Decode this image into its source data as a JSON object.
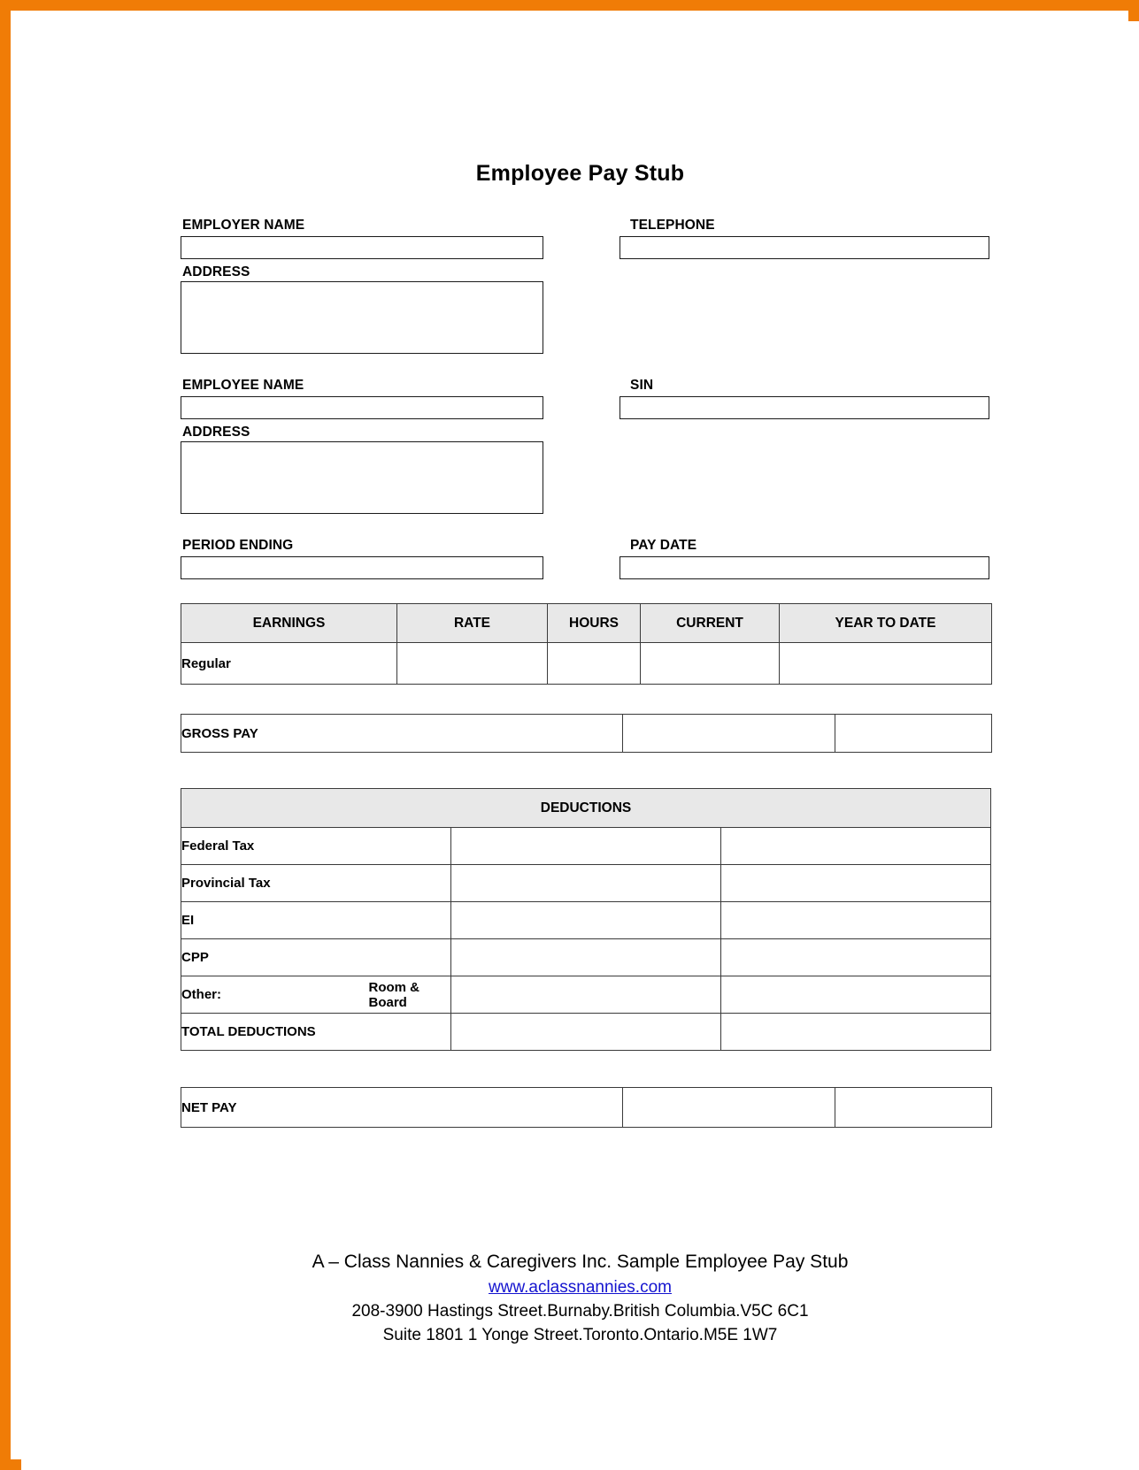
{
  "document": {
    "title": "Employee Pay Stub",
    "accent_border_color": "#f07c06",
    "header_fill_color": "#e8e8e8",
    "link_color": "#1414cf"
  },
  "employer": {
    "name_label": "EMPLOYER NAME",
    "name_value": "",
    "address_label": "ADDRESS",
    "address_value": "",
    "telephone_label": "TELEPHONE",
    "telephone_value": ""
  },
  "employee": {
    "name_label": "EMPLOYEE NAME",
    "name_value": "",
    "address_label": "ADDRESS",
    "address_value": "",
    "sin_label": "SIN",
    "sin_value": ""
  },
  "period": {
    "period_ending_label": "PERIOD ENDING",
    "period_ending_value": "",
    "pay_date_label": "PAY DATE",
    "pay_date_value": ""
  },
  "earnings": {
    "headers": [
      "EARNINGS",
      "RATE",
      "HOURS",
      "CURRENT",
      "YEAR TO DATE"
    ],
    "rows": [
      {
        "label": "Regular",
        "rate": "",
        "hours": "",
        "current": "",
        "ytd": ""
      }
    ]
  },
  "gross_pay": {
    "label": "GROSS PAY",
    "current": "",
    "ytd": ""
  },
  "deductions": {
    "header": "DEDUCTIONS",
    "rows": [
      {
        "label": "Federal Tax",
        "sublabel": "",
        "current": "",
        "ytd": ""
      },
      {
        "label": "Provincial Tax",
        "sublabel": "",
        "current": "",
        "ytd": ""
      },
      {
        "label": "EI",
        "sublabel": "",
        "current": "",
        "ytd": ""
      },
      {
        "label": "CPP",
        "sublabel": "",
        "current": "",
        "ytd": ""
      },
      {
        "label": "Other:",
        "sublabel": "Room & Board",
        "current": "",
        "ytd": ""
      },
      {
        "label": "TOTAL DEDUCTIONS",
        "sublabel": "",
        "current": "",
        "ytd": ""
      }
    ]
  },
  "net_pay": {
    "label": "NET PAY",
    "current": "",
    "ytd": ""
  },
  "footer": {
    "company_line": "A – Class Nannies & Caregivers Inc. Sample Employee Pay Stub",
    "website": "www.aclassnannies.com",
    "address_line_1": "208-3900 Hastings Street.Burnaby.British Columbia.V5C 6C1",
    "address_line_2": "Suite 1801 1 Yonge Street.Toronto.Ontario.M5E 1W7"
  }
}
